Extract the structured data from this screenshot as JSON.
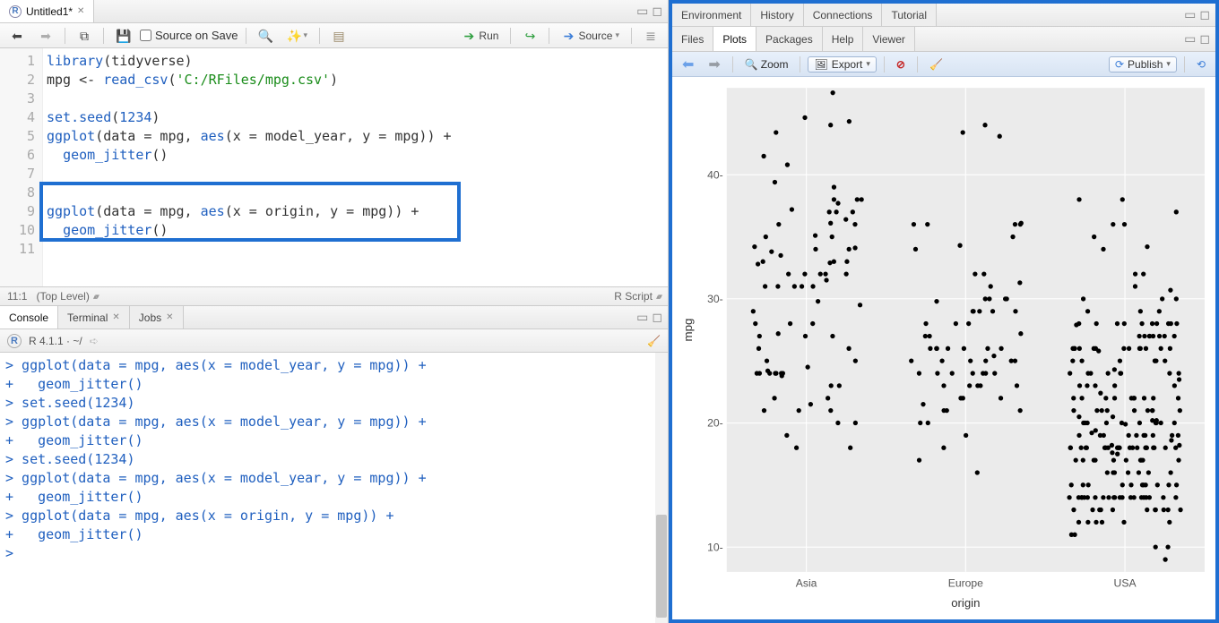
{
  "source_pane": {
    "tab_title": "Untitled1",
    "tab_dirty": true,
    "toolbar": {
      "source_on_save": "Source on Save",
      "run_label": "Run",
      "source_label": "Source"
    },
    "gutter_lines": [
      "1",
      "2",
      "3",
      "4",
      "5",
      "6",
      "7",
      "8",
      "9",
      "10",
      "11"
    ],
    "code_lines": [
      {
        "raw": "library(tidyverse)"
      },
      {
        "raw": "mpg <- read_csv('C:/RFiles/mpg.csv')"
      },
      {
        "raw": ""
      },
      {
        "raw": "set.seed(1234)"
      },
      {
        "raw": "ggplot(data = mpg, aes(x = model_year, y = mpg)) +"
      },
      {
        "raw": "  geom_jitter()"
      },
      {
        "raw": ""
      },
      {
        "raw": ""
      },
      {
        "raw": "ggplot(data = mpg, aes(x = origin, y = mpg)) +"
      },
      {
        "raw": "  geom_jitter()"
      },
      {
        "raw": ""
      }
    ],
    "highlight": {
      "start_line": 8,
      "end_line": 10
    },
    "status": {
      "cursor": "11:1",
      "scope": "(Top Level)",
      "lang": "R Script"
    }
  },
  "console_pane": {
    "tabs": [
      "Console",
      "Terminal",
      "Jobs"
    ],
    "active_tab": 0,
    "header": "R 4.1.1 · ~/",
    "lines": [
      "> ggplot(data = mpg, aes(x = model_year, y = mpg)) +",
      "+   geom_jitter()",
      "> set.seed(1234)",
      "> ggplot(data = mpg, aes(x = model_year, y = mpg)) +",
      "+   geom_jitter()",
      "> set.seed(1234)",
      "> ggplot(data = mpg, aes(x = model_year, y = mpg)) +",
      "+   geom_jitter()",
      "> ggplot(data = mpg, aes(x = origin, y = mpg)) +",
      "+   geom_jitter()",
      "> "
    ]
  },
  "right_pane": {
    "top_tabs": [
      "Environment",
      "History",
      "Connections",
      "Tutorial"
    ],
    "inner_tabs": [
      "Files",
      "Plots",
      "Packages",
      "Help",
      "Viewer"
    ],
    "inner_active": 1,
    "plot_toolbar": {
      "zoom": "Zoom",
      "export": "Export",
      "publish": "Publish"
    }
  },
  "chart_data": {
    "type": "scatter",
    "title": "",
    "xlabel": "origin",
    "ylabel": "mpg",
    "x_type": "categorical",
    "categories": [
      "Asia",
      "Europe",
      "USA"
    ],
    "ylim": [
      8,
      47
    ],
    "y_ticks": [
      10,
      20,
      30,
      40
    ],
    "jitter_width": 0.35,
    "series": [
      {
        "name": "Asia",
        "mpg_values": [
          18,
          24,
          24,
          27,
          27,
          25,
          31,
          35,
          24,
          19,
          28,
          23,
          27,
          20,
          22,
          18,
          21,
          32.8,
          39.4,
          36.1,
          22,
          21,
          24,
          24.5,
          29,
          33,
          20,
          32,
          31,
          31,
          32,
          28,
          24,
          26,
          24,
          28,
          25,
          31,
          26,
          24,
          21.5,
          23,
          21,
          37,
          32,
          33.5,
          31.5,
          29.5,
          24.2,
          27.2,
          23.8,
          37.7,
          34.2,
          34.1,
          35.1,
          31,
          37.2,
          38,
          36,
          38,
          40.8,
          44.3,
          43.4,
          41.5,
          44,
          44.6,
          46.6,
          36.4,
          33.8,
          29.8,
          32.9,
          39,
          35,
          37,
          34,
          38,
          36,
          33,
          32,
          37,
          33,
          34,
          32
        ]
      },
      {
        "name": "Europe",
        "mpg_values": [
          25,
          26,
          24,
          25,
          26,
          21,
          22,
          23,
          30,
          30,
          22,
          26,
          28,
          18,
          29,
          26,
          24,
          25,
          24,
          24,
          26,
          25.4,
          27.2,
          22,
          21.5,
          36.1,
          29,
          24,
          24,
          23,
          20,
          32,
          25,
          23,
          20,
          21,
          19,
          21,
          27,
          28,
          29,
          26,
          24,
          23,
          36,
          31,
          29,
          26,
          23,
          25,
          35,
          43.1,
          30,
          36,
          44,
          29.8,
          34.3,
          31.3,
          34,
          32,
          36,
          28,
          30,
          16,
          17,
          25,
          29,
          27,
          43.4,
          36
        ]
      },
      {
        "name": "USA",
        "mpg_values": [
          18,
          15,
          18,
          16,
          17,
          15,
          14,
          14,
          14,
          15,
          15,
          14,
          24,
          22,
          18,
          21,
          27,
          26,
          25,
          24,
          25,
          26,
          21,
          10,
          10,
          11,
          9,
          27,
          28,
          25,
          19,
          16,
          17,
          19,
          18,
          14,
          14,
          14,
          14,
          12,
          13,
          13,
          18,
          22,
          19,
          18,
          23,
          28,
          30,
          30,
          31,
          35,
          27,
          26,
          24,
          15,
          16,
          14,
          16,
          18,
          14,
          15,
          14,
          21,
          22,
          21,
          12,
          13,
          13,
          14,
          13,
          12,
          13,
          14,
          13,
          12,
          18,
          18,
          23,
          11,
          12,
          13,
          12,
          18,
          20,
          21,
          22,
          18,
          17,
          19,
          18,
          17,
          18,
          21,
          16,
          18,
          17,
          15,
          13,
          14,
          14,
          14,
          28,
          26,
          18,
          22,
          26,
          14,
          20,
          20,
          18,
          17,
          25,
          27,
          17,
          28,
          29,
          27,
          16,
          18,
          15,
          26,
          28,
          24,
          14,
          14,
          15,
          14,
          26,
          28,
          29,
          22,
          23,
          22,
          19,
          19,
          18,
          17,
          22,
          26,
          24,
          13,
          13,
          14,
          15,
          16,
          20,
          21,
          20,
          23,
          19,
          19,
          21,
          20,
          18,
          20,
          24,
          25,
          22,
          20,
          26,
          28,
          26,
          28,
          27,
          23,
          19,
          18,
          20,
          17.5,
          24,
          15,
          17,
          20,
          20.5,
          18.6,
          18.2,
          19.9,
          24.3,
          25.8,
          30,
          22.4,
          27.9,
          36,
          37,
          29,
          26,
          25,
          30.7,
          38,
          36,
          28,
          26,
          24,
          27,
          20.2,
          21,
          19,
          18,
          23.5,
          19.4,
          20.2,
          17,
          18.2,
          20.5,
          19.2,
          17.6,
          34.2,
          34,
          32,
          38,
          28,
          26,
          22,
          32,
          27,
          25
        ]
      }
    ]
  }
}
